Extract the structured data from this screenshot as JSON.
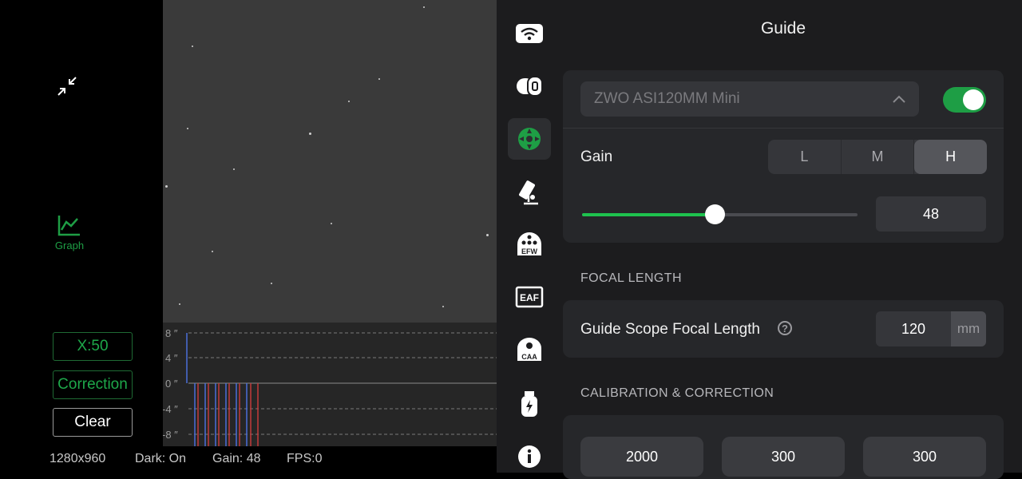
{
  "left": {
    "graph_label": "Graph",
    "xscale_label": "X:50",
    "correction_label": "Correction",
    "clear_label": "Clear"
  },
  "graph": {
    "y_ticks": [
      "8 ″",
      "4 ″",
      "0 ″",
      "-4 ″",
      "-8 ″"
    ]
  },
  "status": {
    "resolution": "1280x960",
    "dark": "Dark: On",
    "gain": "Gain: 48",
    "fps": "FPS:0"
  },
  "sidebar": {
    "items": [
      {
        "icon": "wifi-icon"
      },
      {
        "icon": "camera-icon"
      },
      {
        "icon": "guide-icon",
        "active": true
      },
      {
        "icon": "telescope-icon"
      },
      {
        "icon": "filter-wheel-icon",
        "label": "EFW"
      },
      {
        "icon": "focuser-icon",
        "label": "EAF"
      },
      {
        "icon": "rotator-icon",
        "label": "CAA"
      },
      {
        "icon": "power-icon"
      },
      {
        "icon": "info-icon"
      }
    ]
  },
  "settings": {
    "title": "Guide",
    "camera": {
      "selected": "ZWO ASI120MM Mini",
      "enabled": true
    },
    "gain": {
      "label": "Gain",
      "options": [
        "L",
        "M",
        "H"
      ],
      "selected": "H",
      "value": "48",
      "slider_fraction": 0.48
    },
    "focal_length": {
      "section": "FOCAL LENGTH",
      "label": "Guide Scope Focal Length",
      "value": "120",
      "unit": "mm"
    },
    "calibration": {
      "section": "CALIBRATION & CORRECTION",
      "values": [
        "2000",
        "300",
        "300"
      ]
    }
  },
  "colors": {
    "accent_green": "#1e9e45",
    "ra_line": "#4a6fd8",
    "dec_line": "#c23a3a"
  }
}
